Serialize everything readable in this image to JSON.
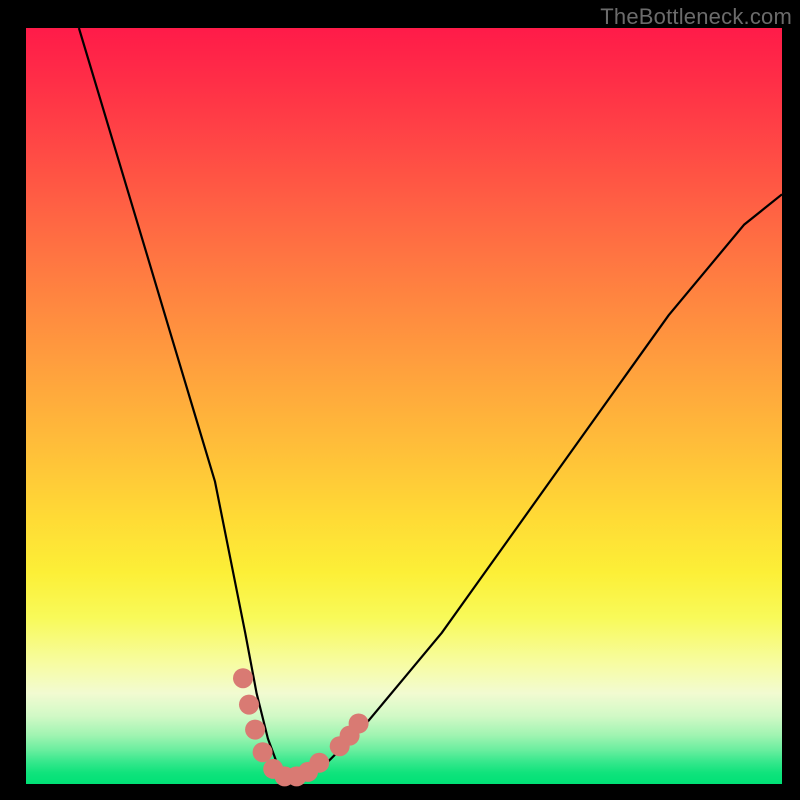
{
  "watermark": "TheBottleneck.com",
  "colors": {
    "frame": "#000000",
    "curve_stroke": "#000000",
    "marker_fill": "#d97a73",
    "gradient_top": "#ff1b49",
    "gradient_bottom": "#00e176"
  },
  "chart_data": {
    "type": "line",
    "title": "",
    "xlabel": "",
    "ylabel": "",
    "xlim": [
      0,
      100
    ],
    "ylim": [
      0,
      100
    ],
    "grid": false,
    "legend": false,
    "background": "vertical gradient (red → orange → yellow → green)",
    "series": [
      {
        "name": "curve",
        "x": [
          7,
          10,
          13,
          16,
          19,
          22,
          25,
          27,
          29,
          30.5,
          32,
          33.3,
          34.5,
          36,
          38,
          40,
          42,
          45,
          50,
          55,
          60,
          65,
          70,
          75,
          80,
          85,
          90,
          95,
          100
        ],
        "y": [
          100,
          90,
          80,
          70,
          60,
          50,
          40,
          30,
          20,
          12,
          6,
          2.5,
          1,
          1,
          1.5,
          3,
          5,
          8,
          14,
          20,
          27,
          34,
          41,
          48,
          55,
          62,
          68,
          74,
          78
        ]
      }
    ],
    "markers": [
      {
        "x": 28.7,
        "y": 14.0
      },
      {
        "x": 29.5,
        "y": 10.5
      },
      {
        "x": 30.3,
        "y": 7.2
      },
      {
        "x": 31.3,
        "y": 4.2
      },
      {
        "x": 32.7,
        "y": 2.0
      },
      {
        "x": 34.2,
        "y": 1.0
      },
      {
        "x": 35.8,
        "y": 1.0
      },
      {
        "x": 37.3,
        "y": 1.6
      },
      {
        "x": 38.8,
        "y": 2.8
      },
      {
        "x": 41.5,
        "y": 5.0
      },
      {
        "x": 42.8,
        "y": 6.4
      },
      {
        "x": 44.0,
        "y": 8.0
      }
    ]
  }
}
